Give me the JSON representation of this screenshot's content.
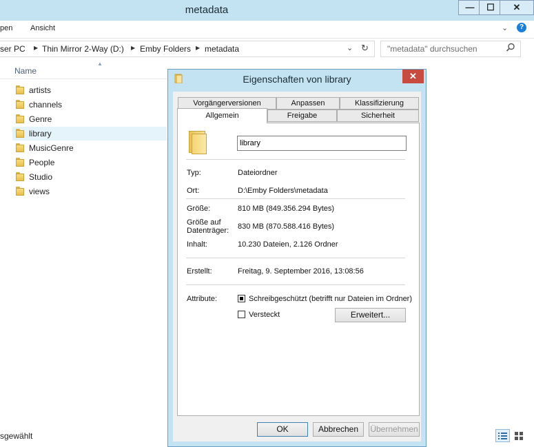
{
  "explorer": {
    "title": "metadata",
    "window_buttons": {
      "minimize": "—",
      "maximize": "☐",
      "close": "✕"
    },
    "ribbon_tabs": [
      "pen",
      "Ansicht"
    ],
    "breadcrumb": [
      "ser PC",
      "Thin Mirror 2-Way (D:)",
      "Emby Folders",
      "metadata"
    ],
    "search_placeholder": "\"metadata\" durchsuchen",
    "column_name": "Name",
    "items": [
      {
        "label": "artists",
        "selected": false
      },
      {
        "label": "channels",
        "selected": false
      },
      {
        "label": "Genre",
        "selected": false
      },
      {
        "label": "library",
        "selected": true
      },
      {
        "label": "MusicGenre",
        "selected": false
      },
      {
        "label": "People",
        "selected": false
      },
      {
        "label": "Studio",
        "selected": false
      },
      {
        "label": "views",
        "selected": false
      }
    ],
    "status_text": "sgewählt"
  },
  "dialog": {
    "title": "Eigenschaften von library",
    "tabs_back": [
      "Vorgängerversionen",
      "Anpassen",
      "Klassifizierung"
    ],
    "tabs_front": [
      "Allgemein",
      "Freigabe",
      "Sicherheit"
    ],
    "active_tab": "Allgemein",
    "name_value": "library",
    "fields": {
      "type_label": "Typ:",
      "type_value": "Dateiordner",
      "location_label": "Ort:",
      "location_value": "D:\\Emby Folders\\metadata",
      "size_label": "Größe:",
      "size_value": "810 MB (849.356.294 Bytes)",
      "disk_size_label_1": "Größe auf",
      "disk_size_label_2": "Datenträger:",
      "disk_size_value": "830 MB (870.588.416 Bytes)",
      "contents_label": "Inhalt:",
      "contents_value": "10.230 Dateien, 2.126 Ordner",
      "created_label": "Erstellt:",
      "created_value": "Freitag, 9. September 2016, 13:08:56",
      "attributes_label": "Attribute:",
      "readonly_label": "Schreibgeschützt (betrifft nur Dateien im Ordner)",
      "hidden_label": "Versteckt",
      "advanced_button": "Erweitert..."
    },
    "buttons": {
      "ok": "OK",
      "cancel": "Abbrechen",
      "apply": "Übernehmen"
    }
  }
}
